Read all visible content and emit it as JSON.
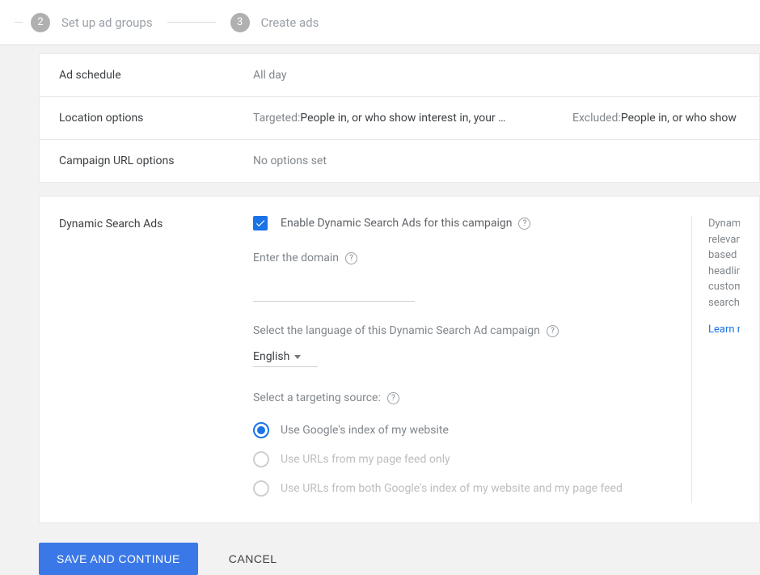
{
  "stepper": {
    "step2": {
      "num": "2",
      "label": "Set up ad groups"
    },
    "step3": {
      "num": "3",
      "label": "Create ads"
    }
  },
  "settings": {
    "adSchedule": {
      "label": "Ad schedule",
      "value": "All day"
    },
    "locationOptions": {
      "label": "Location options",
      "targetedPrefix": "Targeted: ",
      "targetedValue": "People in, or who show interest in, your …",
      "excludedPrefix": "Excluded: ",
      "excludedValue": "People in, or who show interest in, your …"
    },
    "urlOptions": {
      "label": "Campaign URL options",
      "value": "No options set"
    }
  },
  "dsa": {
    "sectionLabel": "Dynamic Search Ads",
    "enableLabel": "Enable Dynamic Search Ads for this campaign",
    "domainLabel": "Enter the domain",
    "domainValue": "",
    "langLabel": "Select the language of this Dynamic Search Ad campaign",
    "langValue": "English",
    "targetingLabel": "Select a targeting source:",
    "radios": {
      "google": "Use Google's index of my website",
      "feed": "Use URLs from my page feed only",
      "both": "Use URLs from both Google's index of my website and my page feed"
    },
    "side": {
      "l1": "Dynamic Search Ads target",
      "l2": "relevant searches automatically",
      "l3": "based on your website, then use",
      "l4": "headlines automatically",
      "l5": "customized to people's actual",
      "l6": "searches.",
      "learn": "Learn more"
    }
  },
  "footer": {
    "save": "SAVE AND CONTINUE",
    "cancel": "CANCEL"
  }
}
